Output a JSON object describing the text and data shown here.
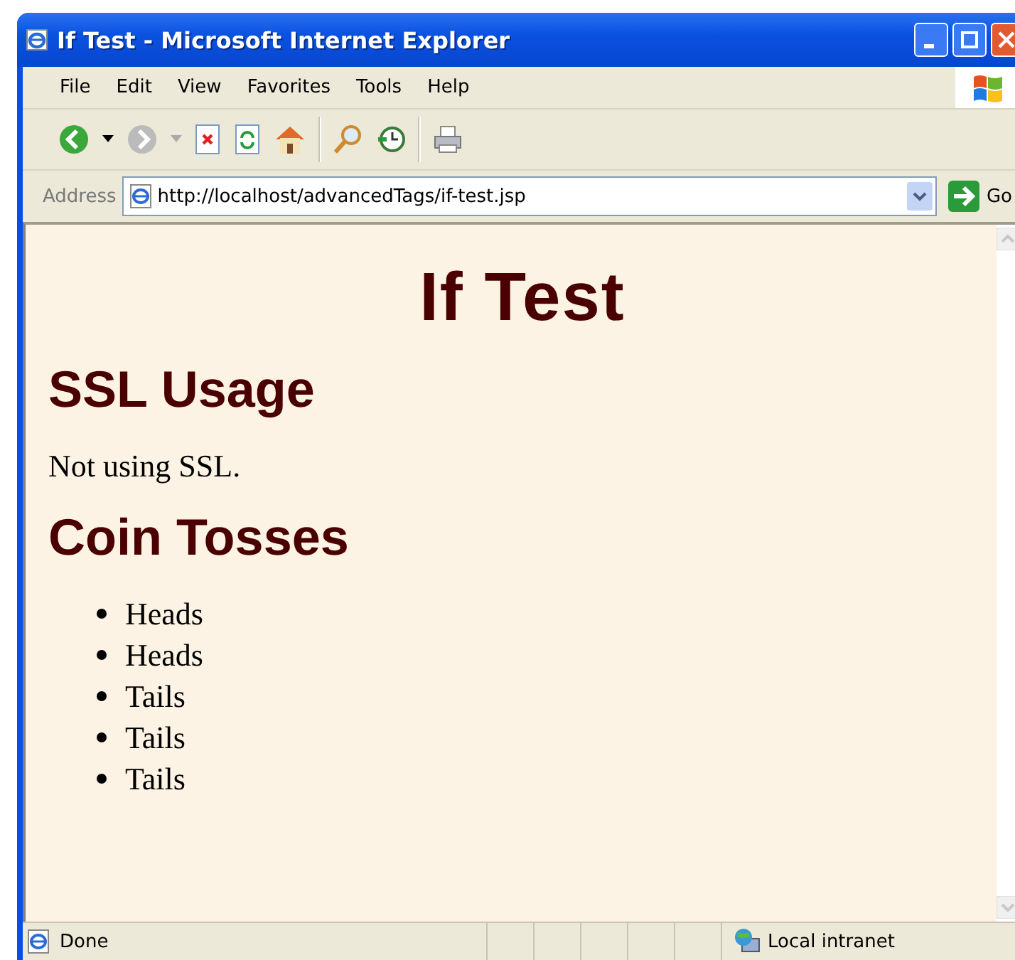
{
  "window": {
    "title": "If Test - Microsoft Internet Explorer"
  },
  "menu": [
    "File",
    "Edit",
    "View",
    "Favorites",
    "Tools",
    "Help"
  ],
  "address": {
    "label": "Address",
    "url": "http://localhost/advancedTags/if-test.jsp",
    "go": "Go"
  },
  "page": {
    "title": "If Test",
    "sections": [
      {
        "kind": "paragraph",
        "heading": "SSL Usage",
        "text": "Not using SSL."
      },
      {
        "kind": "list",
        "heading": "Coin Tosses",
        "items": [
          "Heads",
          "Heads",
          "Tails",
          "Tails",
          "Tails"
        ]
      }
    ]
  },
  "status_bar": {
    "text": "Done",
    "zone": "Local intranet"
  }
}
